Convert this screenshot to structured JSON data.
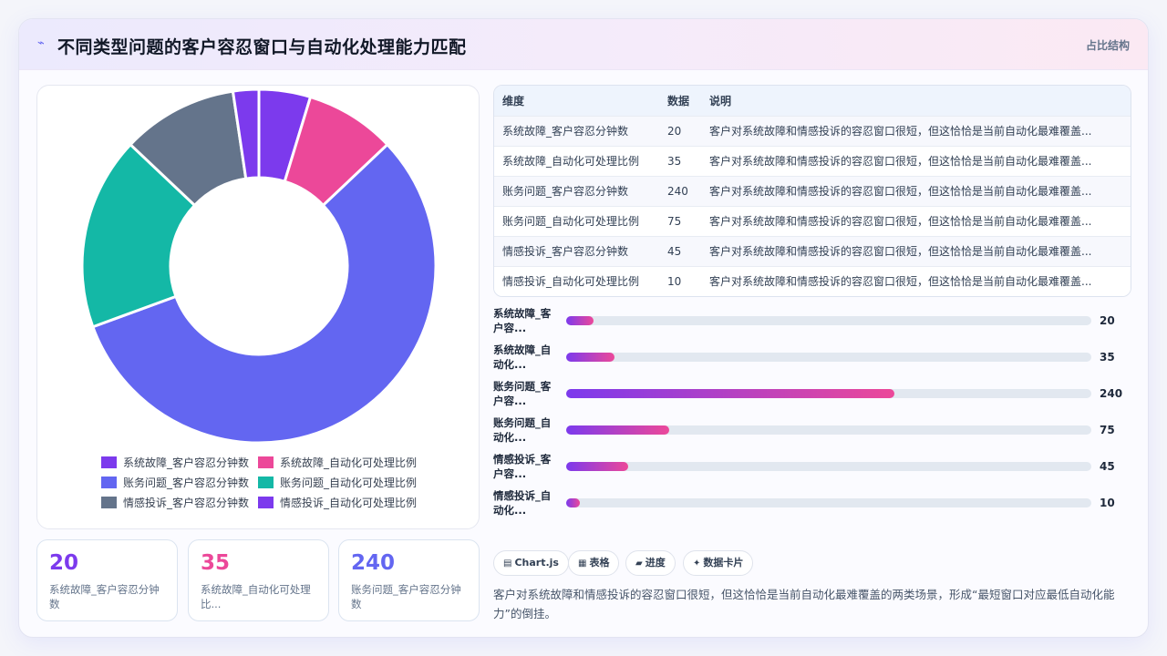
{
  "header": {
    "icon": "zap-icon",
    "title": "不同类型问题的客户容忍窗口与自动化处理能力匹配",
    "tag": "占比结构"
  },
  "colors": {
    "accent": "#6366f1",
    "bar_gradient": [
      "#7c3aed",
      "#ec4899"
    ],
    "series": [
      "#7c3aed",
      "#ec4899",
      "#6366f1",
      "#14b8a6",
      "#64748b",
      "#7c3aed"
    ]
  },
  "chart_data": {
    "type": "pie",
    "variant": "doughnut",
    "categories": [
      "系统故障_客户容忍分钟数",
      "系统故障_自动化可处理比例",
      "账务问题_客户容忍分钟数",
      "账务问题_自动化可处理比例",
      "情感投诉_客户容忍分钟数",
      "情感投诉_自动化可处理比例"
    ],
    "values": [
      20,
      35,
      240,
      75,
      45,
      10
    ],
    "legend_position": "bottom",
    "hidden_categories": []
  },
  "legend": [
    {
      "label": "系统故障_客户容忍分钟数",
      "color": "#7c3aed"
    },
    {
      "label": "系统故障_自动化可处理比例",
      "color": "#ec4899"
    },
    {
      "label": "账务问题_客户容忍分钟数",
      "color": "#6366f1"
    },
    {
      "label": "账务问题_自动化可处理比例",
      "color": "#14b8a6"
    },
    {
      "label": "情感投诉_客户容忍分钟数",
      "color": "#64748b"
    },
    {
      "label": "情感投诉_自动化可处理比例",
      "color": "#7c3aed"
    }
  ],
  "stats": [
    {
      "value": "20",
      "label": "系统故障_客户容忍分钟数",
      "color": "#7c3aed"
    },
    {
      "value": "35",
      "label": "系统故障_自动化可处理比...",
      "color": "#ec4899"
    },
    {
      "value": "240",
      "label": "账务问题_客户容忍分钟数",
      "color": "#6366f1"
    }
  ],
  "table": {
    "headers": [
      "维度",
      "数据",
      "说明"
    ],
    "rows": [
      [
        "系统故障_客户容忍分钟数",
        "20",
        "客户对系统故障和情感投诉的容忍窗口很短，但这恰恰是当前自动化最难覆盖..."
      ],
      [
        "系统故障_自动化可处理比例",
        "35",
        "客户对系统故障和情感投诉的容忍窗口很短，但这恰恰是当前自动化最难覆盖..."
      ],
      [
        "账务问题_客户容忍分钟数",
        "240",
        "客户对系统故障和情感投诉的容忍窗口很短，但这恰恰是当前自动化最难覆盖..."
      ],
      [
        "账务问题_自动化可处理比例",
        "75",
        "客户对系统故障和情感投诉的容忍窗口很短，但这恰恰是当前自动化最难覆盖..."
      ],
      [
        "情感投诉_客户容忍分钟数",
        "45",
        "客户对系统故障和情感投诉的容忍窗口很短，但这恰恰是当前自动化最难覆盖..."
      ],
      [
        "情感投诉_自动化可处理比例",
        "10",
        "客户对系统故障和情感投诉的容忍窗口很短，但这恰恰是当前自动化最难覆盖..."
      ]
    ]
  },
  "bars": {
    "max": 240,
    "items": [
      {
        "label": "系统故障_客户容...",
        "value": 20,
        "value_text": "20"
      },
      {
        "label": "系统故障_自动化...",
        "value": 35,
        "value_text": "35"
      },
      {
        "label": "账务问题_客户容...",
        "value": 240,
        "value_text": "240"
      },
      {
        "label": "账务问题_自动化...",
        "value": 75,
        "value_text": "75"
      },
      {
        "label": "情感投诉_客户容...",
        "value": 45,
        "value_text": "45"
      },
      {
        "label": "情感投诉_自动化...",
        "value": 10,
        "value_text": "10"
      }
    ]
  },
  "chips": [
    {
      "icon": "▤",
      "icon_name": "chart-icon",
      "label": "Chart.js"
    },
    {
      "icon": "▦",
      "icon_name": "table-icon",
      "label": "表格"
    },
    {
      "icon": "▰",
      "icon_name": "progress-icon",
      "label": "进度"
    },
    {
      "icon": "✦",
      "icon_name": "card-icon",
      "label": "数据卡片"
    }
  ],
  "summary": "客户对系统故障和情感投诉的容忍窗口很短，但这恰恰是当前自动化最难覆盖的两类场景，形成“最短窗口对应最低自动化能力”的倒挂。"
}
